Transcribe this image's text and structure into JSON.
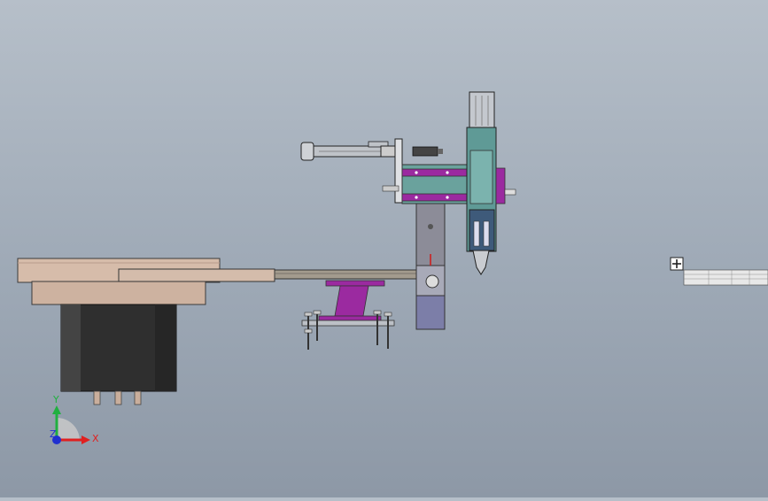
{
  "view": {
    "triad": {
      "x_label": "X",
      "y_label": "Y",
      "z_label": "Z"
    },
    "colors": {
      "background_top": "#b6bfc9",
      "background_bottom": "#8d98a6",
      "plate_tan": "#d2b9a8",
      "motor_body": "#2e2e2e",
      "rail_purple": "#9b2aa0",
      "head_teal": "#5f9a96",
      "bracket_gray": "#8c8c98",
      "cylinder_gray": "#b8bcc2",
      "axis_x": "#e02020",
      "axis_y": "#20b040",
      "axis_z": "#2030d0"
    },
    "icons": {
      "origin_marker": "origin-marker-icon",
      "triad": "coordinate-triad-icon"
    }
  }
}
